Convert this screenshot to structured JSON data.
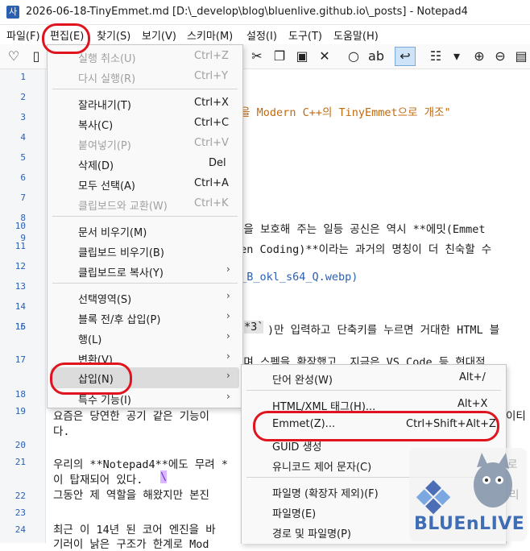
{
  "window": {
    "app_icon_text": "사",
    "title": "2026-06-18-TinyEmmet.md [D:\\_develop\\blog\\bluenlive.github.io\\_posts] - Notepad4"
  },
  "menubar": [
    "파일(F)",
    "편집(E)",
    "찾기(S)",
    "보기(V)",
    "스키마(M)",
    "설정(I)",
    "도구(T)",
    "도움말(H)"
  ],
  "toolbar_icons": [
    "heart-icon",
    "new-icon",
    "cut-icon",
    "copy-icon",
    "paste-icon",
    "delete-icon",
    "find-icon",
    "replace-icon",
    "wrap-icon",
    "scheme-icon",
    "dropdown-icon",
    "zoom-in-icon",
    "zoom-out-icon",
    "page-icon"
  ],
  "line_numbers": [
    "1",
    "2",
    "3",
    "4",
    "5",
    "6",
    "7",
    "8",
    "9",
    "10",
    "11",
    "12",
    "13",
    "14",
    "15",
    "16",
    "17",
    "18",
    "19",
    "20",
    "21",
    "22",
    "23",
    "24"
  ],
  "editor": {
    "line3_tail": "g을 Modern C++의 TinyEmmet으로 개조\"",
    "line10_tail": "락을 보호해 주는 일등 공신은 역시 **에밋(Emmet",
    "line11_tail": "Zen Coding)**이라는 과거의 명칭이 더 친숙할 수",
    "line13_tail": "n_B_okl_s64_Q.webp)",
    "line16_code": "*3`",
    "line16_tail": ")만 입력하고 단축키를 누르면 거대한 HTML 블",
    "line17_tail": "꾸며 스펙을 확장했고, 지금은 VS Code 등 현대적",
    "line19_left": "요즘은 당연한 공기 같은 기능이",
    "line19_right": "이티",
    "line19b": "다.",
    "line21": "우리의 **Notepad4**에도 무려 *",
    "line21_right": "로",
    "line21b": "이 탑재되어 있다.",
    "line21b_cursor": "\\",
    "line22": "그동안 제 역할을 해왔지만 본진",
    "line22_right": "리",
    "line24": "최근 이 14년 된 코어 엔진을 바",
    "line25": "기러이 낡은 구조가 한계로 Mod"
  },
  "edit_menu": {
    "items": [
      {
        "label": "실행 취소(U)",
        "shortcut": "Ctrl+Z",
        "disabled": true
      },
      {
        "label": "다시 실행(R)",
        "shortcut": "Ctrl+Y",
        "disabled": true
      },
      {
        "label": "잘라내기(T)",
        "shortcut": "Ctrl+X",
        "disabled": false
      },
      {
        "label": "복사(C)",
        "shortcut": "Ctrl+C",
        "disabled": false
      },
      {
        "label": "붙여넣기(P)",
        "shortcut": "Ctrl+V",
        "disabled": true
      },
      {
        "label": "삭제(D)",
        "shortcut": "Del",
        "disabled": false
      },
      {
        "label": "모두 선택(A)",
        "shortcut": "Ctrl+A",
        "disabled": false
      },
      {
        "label": "클립보드와 교환(W)",
        "shortcut": "Ctrl+K",
        "disabled": true
      },
      {
        "label": "문서 비우기(M)",
        "shortcut": "",
        "disabled": false
      },
      {
        "label": "클립보드 비우기(B)",
        "shortcut": "",
        "disabled": false
      },
      {
        "label": "클립보드로 복사(Y)",
        "shortcut": "",
        "disabled": false
      },
      {
        "label": "선택영역(S)",
        "shortcut": "",
        "disabled": false
      },
      {
        "label": "블록 전/후 삽입(P)",
        "shortcut": "",
        "disabled": false
      },
      {
        "label": "행(L)",
        "shortcut": "",
        "disabled": false
      },
      {
        "label": "변환(V)",
        "shortcut": "",
        "disabled": false
      },
      {
        "label": "삽입(N)",
        "shortcut": "",
        "disabled": false
      },
      {
        "label": "특수 기능(I)",
        "shortcut": "",
        "disabled": false
      }
    ],
    "arrow": "›"
  },
  "insert_submenu": {
    "items": [
      {
        "label": "단어 완성(W)",
        "shortcut": "Alt+/"
      },
      {
        "label": "HTML/XML 태그(H)...",
        "shortcut": "Alt+X"
      },
      {
        "label": "Emmet(Z)...",
        "shortcut": "Ctrl+Shift+Alt+Z"
      },
      {
        "label": "GUID 생성",
        "shortcut": ""
      },
      {
        "label": "유니코드 제어 문자(C)",
        "shortcut": ""
      },
      {
        "label": "파일명 (확장자 제외)(F)",
        "shortcut": ""
      },
      {
        "label": "파일명(E)",
        "shortcut": ""
      },
      {
        "label": "경로 및 파일명(P)",
        "shortcut": ""
      }
    ],
    "arrow": "›"
  },
  "watermark": {
    "text": "BLUEnLIVE"
  },
  "colors": {
    "highlight_red": "#e0141e",
    "line_number_blue": "#2b5fb0",
    "string_orange": "#c06a10"
  }
}
